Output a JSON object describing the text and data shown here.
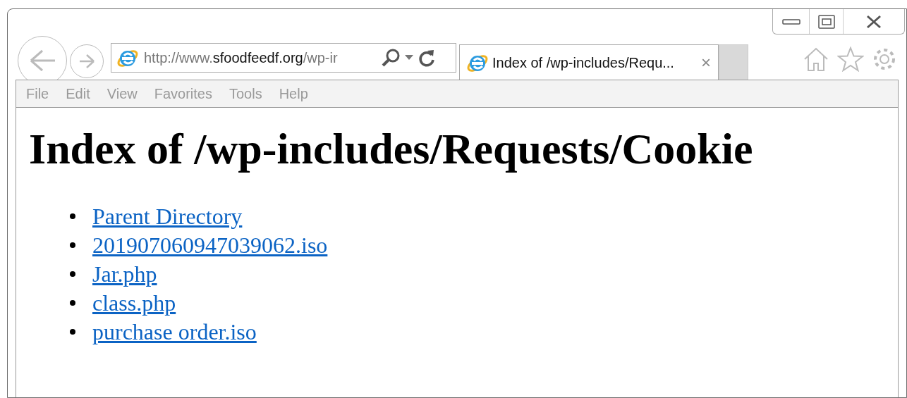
{
  "address_bar": {
    "url_prefix": "http://www.",
    "url_domain": "sfoodfeedf.org",
    "url_path": "/wp-ir"
  },
  "tabs": [
    {
      "title": "Index of /wp-includes/Requ...",
      "close": "×",
      "selected": true
    }
  ],
  "menu": [
    "File",
    "Edit",
    "View",
    "Favorites",
    "Tools",
    "Help"
  ],
  "page": {
    "heading": "Index of /wp-includes/Requests/Cookie",
    "links": [
      "Parent Directory",
      "201907060947039062.iso",
      "Jar.php",
      "class.php",
      "purchase order.iso"
    ]
  }
}
